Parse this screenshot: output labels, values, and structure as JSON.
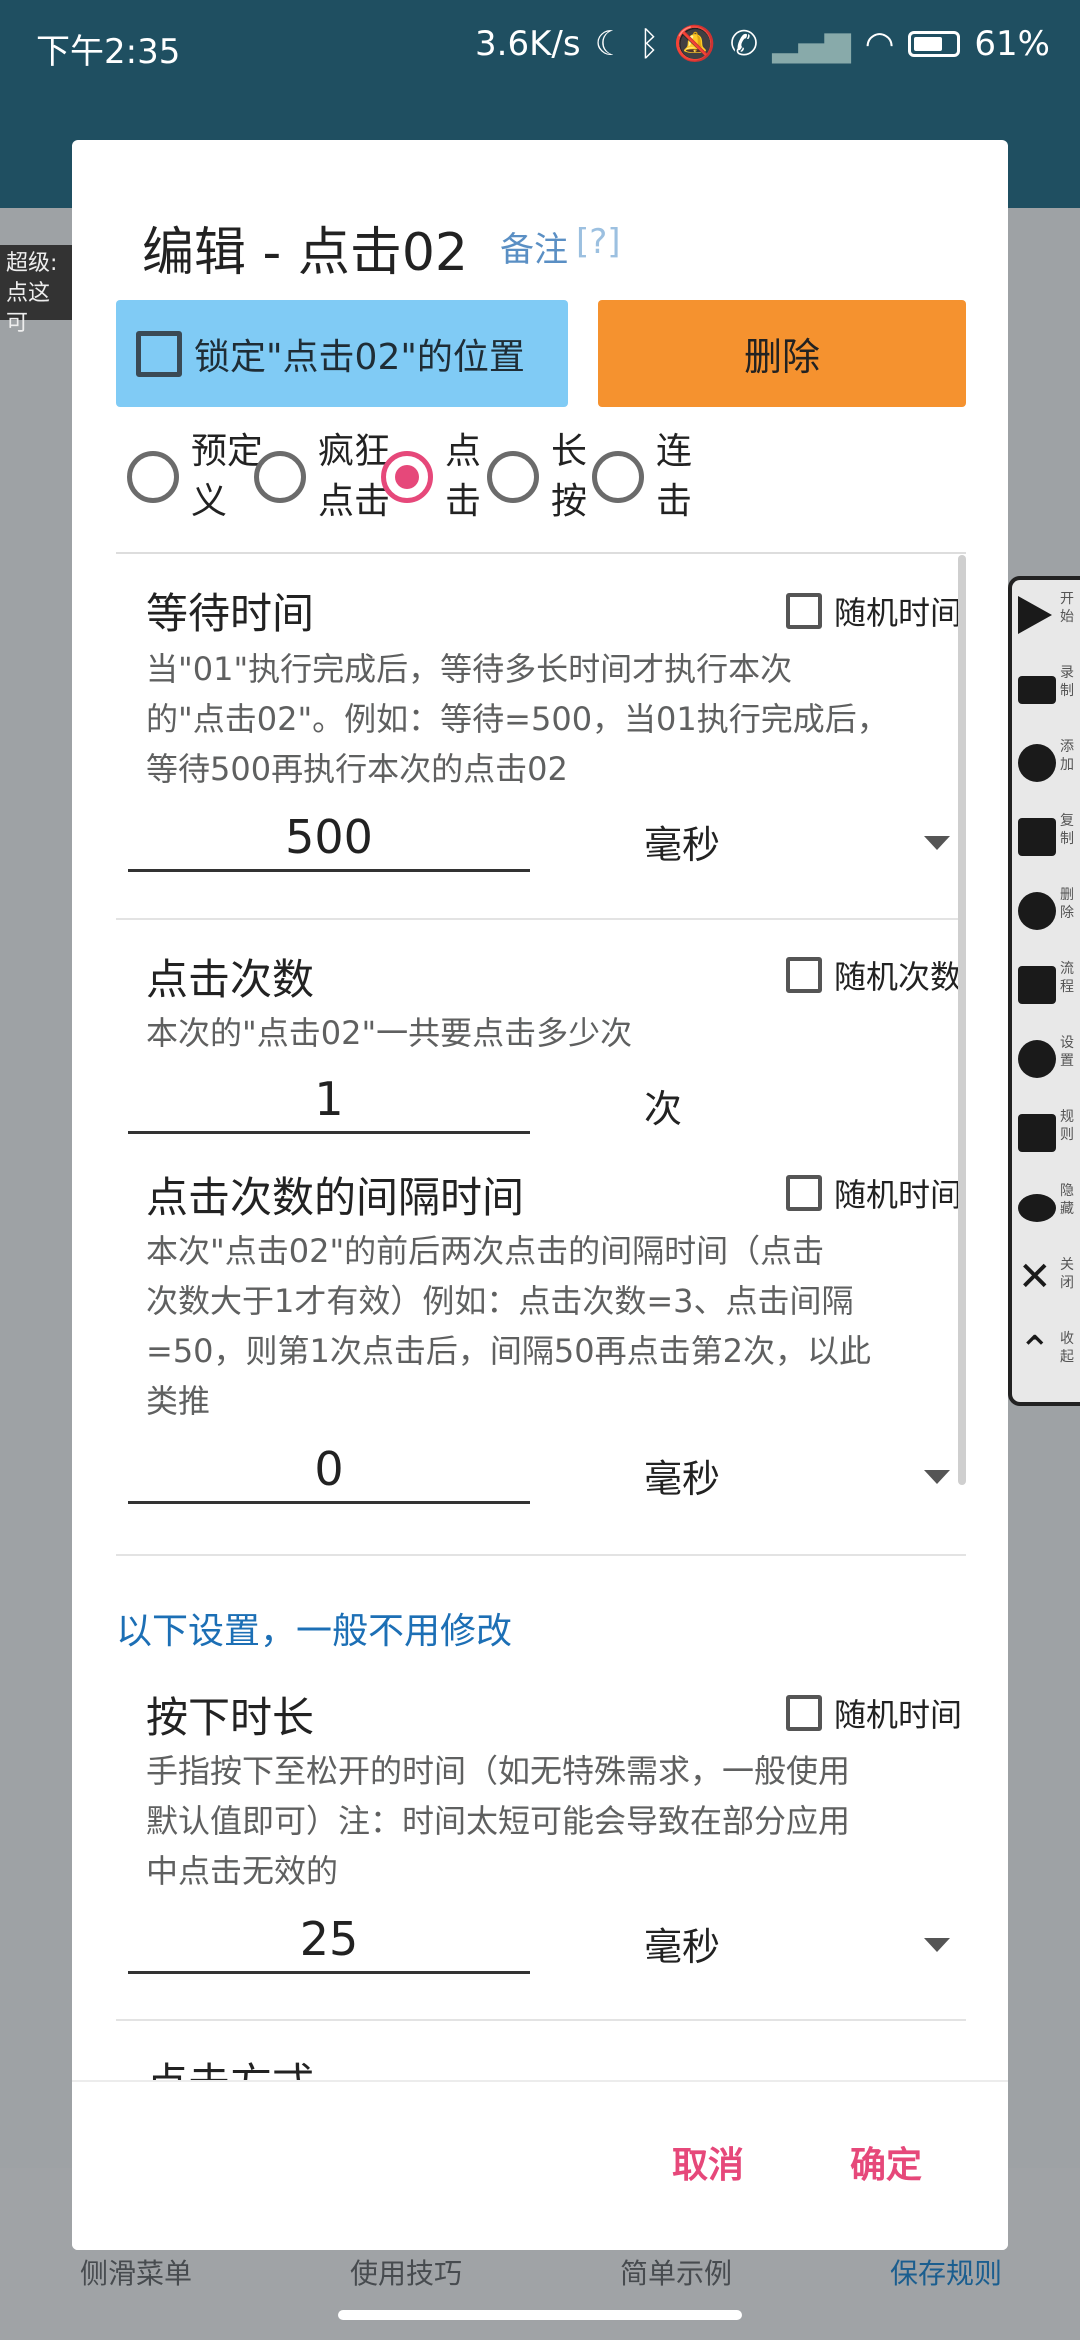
{
  "status_bar": {
    "time": "下午2:35",
    "speed": "3.6K/s",
    "battery": "61%"
  },
  "background": {
    "tip_text": "超级:点这可",
    "bottom_nav": [
      "侧滑菜单",
      "使用技巧",
      "简单示例",
      "保存规则"
    ]
  },
  "float_toolbar": {
    "items": [
      "开始",
      "录制",
      "添加",
      "复制",
      "删除",
      "流程",
      "设置",
      "规则",
      "隐藏",
      "关闭",
      "收起"
    ]
  },
  "dialog": {
    "title": "编辑 - 点击02",
    "note_link": "备注",
    "help_link": "[?]",
    "lock_button": "锁定\"点击02\"的位置",
    "delete_button": "删除",
    "radio_options": [
      {
        "label_line1": "预定",
        "label_line2": "义",
        "checked": false
      },
      {
        "label_line1": "疯狂",
        "label_line2": "点击",
        "checked": false
      },
      {
        "label_line1": "点",
        "label_line2": "击",
        "checked": true
      },
      {
        "label_line1": "长",
        "label_line2": "按",
        "checked": false
      },
      {
        "label_line1": "连",
        "label_line2": "击",
        "checked": false
      }
    ],
    "wait": {
      "title": "等待时间",
      "random_label": "随机时间",
      "desc_1": "当\"01\"执行完成后，等待多长时间才执行本次",
      "desc_2": "的\"点击02\"。例如：等待=500，当01执行完成后，",
      "desc_3": "等待500再执行本次的点击02",
      "value": "500",
      "unit": "毫秒"
    },
    "click_count": {
      "title": "点击次数",
      "random_label": "随机次数",
      "desc_1": "本次的\"点击02\"一共要点击多少次",
      "value": "1",
      "unit": "次"
    },
    "interval": {
      "title": "点击次数的间隔时间",
      "random_label": "随机时间",
      "desc_1": "本次\"点击02\"的前后两次点击的间隔时间（点击",
      "desc_2": "次数大于1才有效）例如：点击次数=3、点击间隔",
      "desc_3": "=50，则第1次点击后，间隔50再点击第2次，以此",
      "desc_4": "类推",
      "value": "0",
      "unit": "毫秒"
    },
    "advanced_hint": "以下设置，一般不用修改",
    "press_duration": {
      "title": "按下时长",
      "random_label": "随机时间",
      "desc_1": "手指按下至松开的时间（如无特殊需求，一般使用",
      "desc_2": "默认值即可）注：时间太短可能会导致在部分应用",
      "desc_3": "中点击无效的",
      "value": "25",
      "unit": "毫秒"
    },
    "next_section_title": "点击方式",
    "cancel_button": "取消",
    "confirm_button": "确定"
  }
}
